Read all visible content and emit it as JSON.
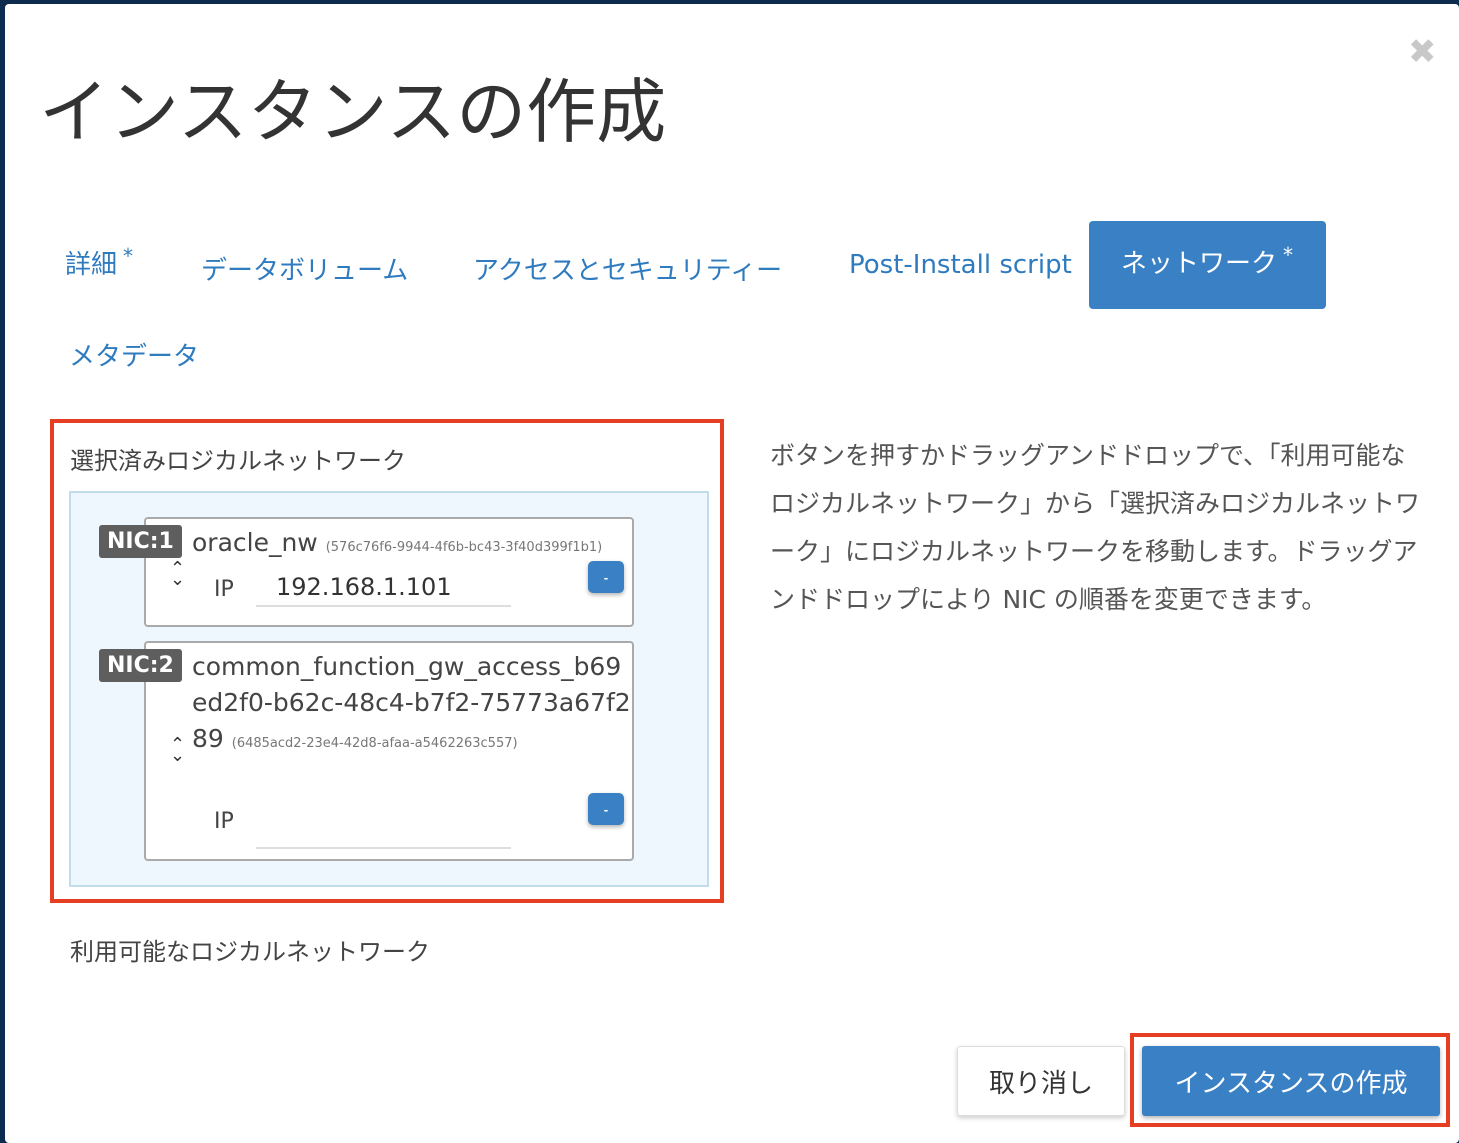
{
  "title": "インスタンスの作成",
  "tabs": [
    {
      "label": "詳細",
      "required": "*"
    },
    {
      "label": "データボリューム"
    },
    {
      "label": "アクセスとセキュリティー"
    },
    {
      "label": "Post-Install script"
    },
    {
      "label": "ネットワーク",
      "required": "*"
    },
    {
      "label": "メタデータ"
    }
  ],
  "selected": {
    "label": "選択済みロジカルネットワーク",
    "nics": [
      {
        "badge": "NIC:1",
        "name": "oracle_nw",
        "id": "(576c76f6-9944-4f6b-bc43-3f40d399f1b1)",
        "ip_label": "IP",
        "ip": "192.168.1.101",
        "remove": "-"
      },
      {
        "badge": "NIC:2",
        "name": "common_function_gw_access_b69ed2f0-b62c-48c4-b7f2-75773a67f289",
        "id": "(6485acd2-23e4-42d8-afaa-a5462263c557)",
        "ip_label": "IP",
        "ip": "",
        "remove": "-"
      }
    ]
  },
  "help": "ボタンを押すかドラッグアンドドロップで、「利用可能なロジカルネットワーク」から「選択済みロジカルネットワーク」にロジカルネットワークを移動します。ドラッグアンドドロップにより NIC の順番を変更できます。",
  "available_label": "利用可能なロジカルネットワーク",
  "buttons": {
    "cancel": "取り消し",
    "create": "インスタンスの作成"
  }
}
